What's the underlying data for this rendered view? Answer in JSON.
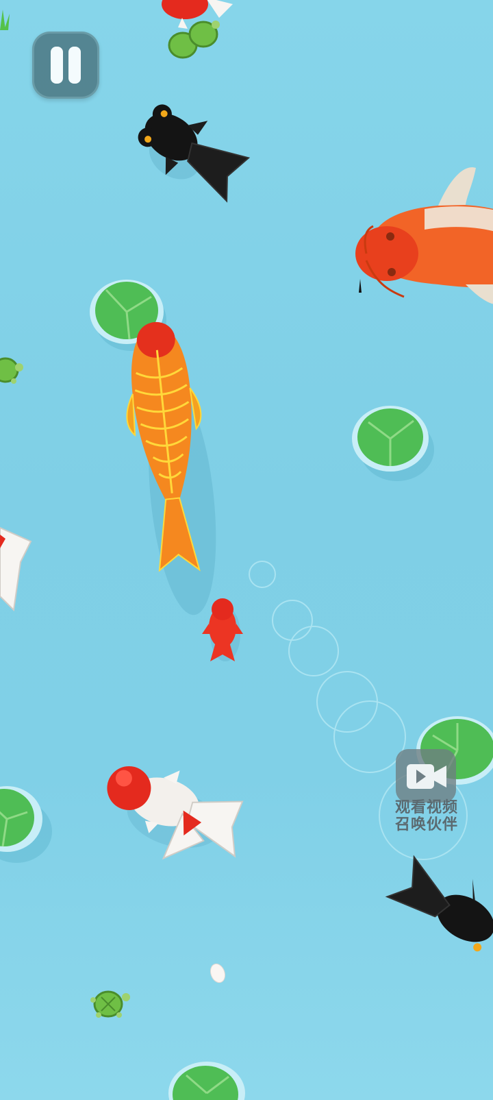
{
  "game": {
    "screen": "koi-pond",
    "water_color": "#80d0e7"
  },
  "controls": {
    "pause_icon": "pause-icon",
    "video_icon": "video-camera-icon",
    "video_label_line1": "观看视频",
    "video_label_line2": "召唤伙伴"
  },
  "colors": {
    "player_koi": "#f5881f",
    "player_koi_scales": "#ffd83a",
    "red_koi": "#f26427",
    "black_fish": "#141414",
    "lily_pad": "#4fbd55",
    "turtle": "#6fbf45"
  }
}
